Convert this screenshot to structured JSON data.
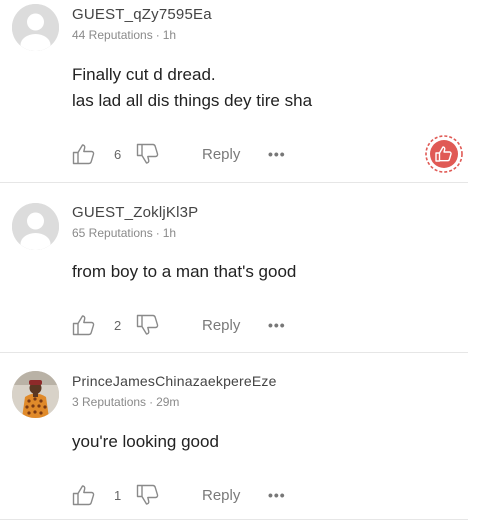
{
  "comments": [
    {
      "username": "GUEST_qZy7595Ea",
      "reputations": "44 Reputations",
      "time": "1h",
      "lines": [
        "Finally cut d dread.",
        "las lad all dis things dey tire sha"
      ],
      "likes": "6",
      "reply_label": "Reply",
      "more_label": "•••",
      "avatar": "default-avatar-icon"
    },
    {
      "username": "GUEST_ZokljKl3P",
      "reputations": "65 Reputations",
      "time": "1h",
      "lines": [
        "from boy to a man that's good"
      ],
      "likes": "2",
      "reply_label": "Reply",
      "more_label": "•••",
      "avatar": "default-avatar-icon"
    },
    {
      "username": "PrinceJamesChinazaekpereEze",
      "reputations": "3 Reputations",
      "time": "29m",
      "lines": [
        "you're looking good"
      ],
      "likes": "1",
      "reply_label": "Reply",
      "more_label": "•••",
      "avatar": "user-photo"
    }
  ],
  "colors": {
    "accent_red": "#e05a55",
    "text": "#222222",
    "muted": "#8a8a8a",
    "divider": "#e6e6e6"
  }
}
